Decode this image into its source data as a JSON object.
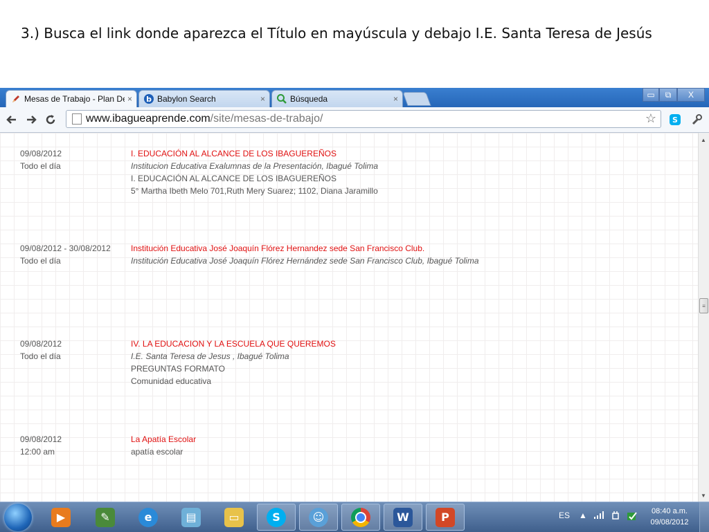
{
  "slide": {
    "instruction": "3.) Busca el link donde aparezca el Título en mayúscula y debajo I.E. Santa Teresa de Jesús"
  },
  "browser": {
    "tabs": [
      {
        "label": "Mesas de Trabajo - Plan De",
        "icon": "pencil-icon",
        "active": true
      },
      {
        "label": "Babylon Search",
        "icon": "babylon-icon",
        "active": false
      },
      {
        "label": "Búsqueda",
        "icon": "search-icon",
        "active": false
      }
    ],
    "tab_close": "×",
    "window_controls": {
      "minimize": "▭",
      "maximize": "⧉",
      "close": "X"
    },
    "address": {
      "host": "www.ibagueaprende.com",
      "path": "/site/mesas-de-trabajo/"
    }
  },
  "events": [
    {
      "date": "09/08/2012",
      "time": "Todo el día",
      "title": "I. EDUCACIÓN AL ALCANCE DE LOS IBAGUEREÑOS",
      "location": "Institucion Educativa Exalumnas de la Presentación, Ibagué Tolima",
      "details": [
        "I. EDUCACIÓN AL ALCANCE DE LOS IBAGUEREÑOS",
        "5° Martha Ibeth Melo 701,Ruth Mery Suarez; 1102, Diana Jaramillo"
      ]
    },
    {
      "date": "09/08/2012 - 30/08/2012",
      "time": "Todo el día",
      "title": "Institución Educativa José Joaquín Flórez Hernandez sede San Francisco Club.",
      "location": "Institución Educativa José Joaquín Flórez Hernández sede San Francisco Club, Ibagué Tolima",
      "details": []
    },
    {
      "date": "09/08/2012",
      "time": "Todo el día",
      "title": "IV. LA EDUCACION Y LA ESCUELA QUE QUEREMOS",
      "location": "I.E. Santa Teresa de Jesus , Ibagué Tolima",
      "details": [
        "PREGUNTAS FORMATO",
        "Comunidad educativa"
      ]
    },
    {
      "date": "09/08/2012",
      "time": "12:00 am",
      "title": "La Apatía Escolar",
      "location": "",
      "details": [
        "apatía escolar"
      ]
    }
  ],
  "taskbar": {
    "apps": [
      {
        "name": "windows-media-player-icon",
        "color": "#e87b1e"
      },
      {
        "name": "paint-tool-icon",
        "color": "#4a8a3a"
      },
      {
        "name": "internet-explorer-icon",
        "color": "#2a8ad8"
      },
      {
        "name": "notepad-icon",
        "color": "#6fb0d8"
      },
      {
        "name": "file-explorer-icon",
        "color": "#e8c24a"
      },
      {
        "name": "skype-icon",
        "color": "#00aff0"
      },
      {
        "name": "messenger-icon",
        "color": "#5aa0d8"
      },
      {
        "name": "chrome-icon",
        "color": "#db4437"
      },
      {
        "name": "word-icon",
        "color": "#2b579a"
      },
      {
        "name": "powerpoint-icon",
        "color": "#d24726"
      }
    ],
    "app_letters": {
      "skype": "S",
      "word": "W",
      "powerpoint": "P"
    },
    "language": "ES",
    "clock_time": "08:40 a.m.",
    "clock_date": "09/08/2012"
  }
}
